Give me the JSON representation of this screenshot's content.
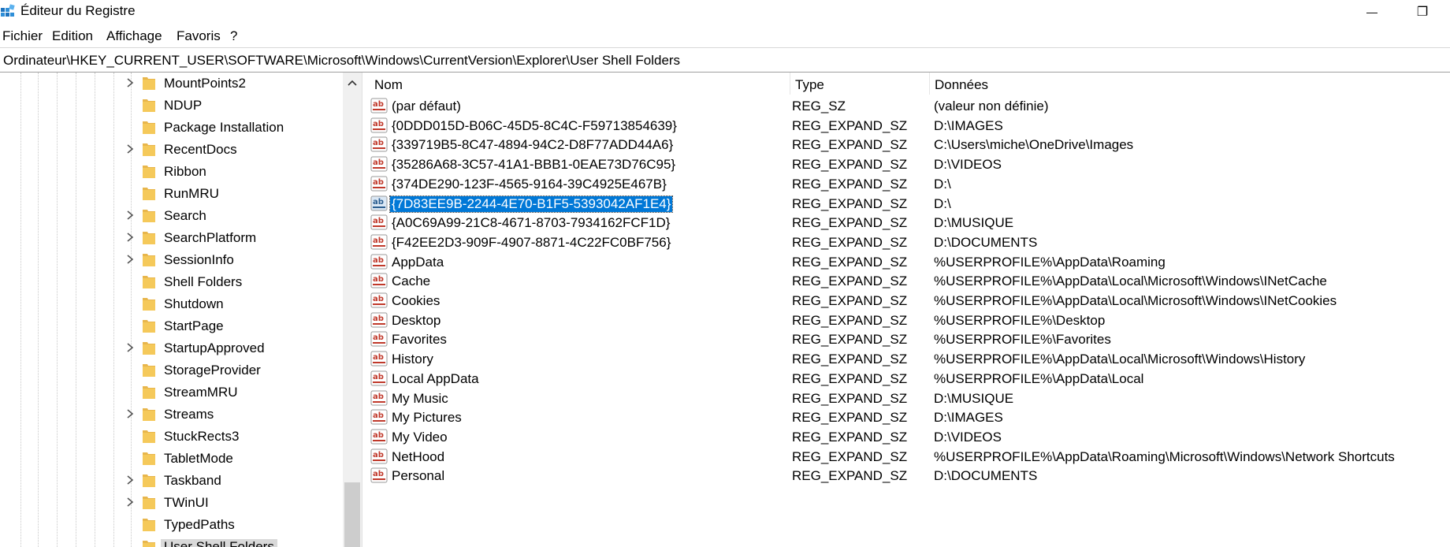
{
  "window": {
    "title": "Éditeur du Registre",
    "controls": {
      "minimize": "—",
      "restore": "❐"
    }
  },
  "menu": [
    "Fichier",
    "Edition",
    "Affichage",
    "Favoris",
    "?"
  ],
  "address": "Ordinateur\\HKEY_CURRENT_USER\\SOFTWARE\\Microsoft\\Windows\\CurrentVersion\\Explorer\\User Shell Folders",
  "tree": [
    {
      "label": "MountPoints2",
      "expandable": true
    },
    {
      "label": "NDUP",
      "expandable": false
    },
    {
      "label": "Package Installation",
      "expandable": false
    },
    {
      "label": "RecentDocs",
      "expandable": true
    },
    {
      "label": "Ribbon",
      "expandable": false
    },
    {
      "label": "RunMRU",
      "expandable": false
    },
    {
      "label": "Search",
      "expandable": true
    },
    {
      "label": "SearchPlatform",
      "expandable": true
    },
    {
      "label": "SessionInfo",
      "expandable": true
    },
    {
      "label": "Shell Folders",
      "expandable": false
    },
    {
      "label": "Shutdown",
      "expandable": false
    },
    {
      "label": "StartPage",
      "expandable": false
    },
    {
      "label": "StartupApproved",
      "expandable": true
    },
    {
      "label": "StorageProvider",
      "expandable": false
    },
    {
      "label": "StreamMRU",
      "expandable": false
    },
    {
      "label": "Streams",
      "expandable": true
    },
    {
      "label": "StuckRects3",
      "expandable": false
    },
    {
      "label": "TabletMode",
      "expandable": false
    },
    {
      "label": "Taskband",
      "expandable": true
    },
    {
      "label": "TWinUI",
      "expandable": true
    },
    {
      "label": "TypedPaths",
      "expandable": false
    },
    {
      "label": "User Shell Folders",
      "expandable": false,
      "selected": true
    }
  ],
  "columns": {
    "name": "Nom",
    "type": "Type",
    "data": "Données"
  },
  "values": [
    {
      "name": "(par défaut)",
      "type": "REG_SZ",
      "data": "(valeur non définie)"
    },
    {
      "name": "{0DDD015D-B06C-45D5-8C4C-F59713854639}",
      "type": "REG_EXPAND_SZ",
      "data": "D:\\IMAGES"
    },
    {
      "name": "{339719B5-8C47-4894-94C2-D8F77ADD44A6}",
      "type": "REG_EXPAND_SZ",
      "data": "C:\\Users\\miche\\OneDrive\\Images"
    },
    {
      "name": "{35286A68-3C57-41A1-BBB1-0EAE73D76C95}",
      "type": "REG_EXPAND_SZ",
      "data": "D:\\VIDEOS"
    },
    {
      "name": "{374DE290-123F-4565-9164-39C4925E467B}",
      "type": "REG_EXPAND_SZ",
      "data": "D:\\"
    },
    {
      "name": "{7D83EE9B-2244-4E70-B1F5-5393042AF1E4}",
      "type": "REG_EXPAND_SZ",
      "data": "D:\\",
      "selected": true
    },
    {
      "name": "{A0C69A99-21C8-4671-8703-7934162FCF1D}",
      "type": "REG_EXPAND_SZ",
      "data": "D:\\MUSIQUE"
    },
    {
      "name": "{F42EE2D3-909F-4907-8871-4C22FC0BF756}",
      "type": "REG_EXPAND_SZ",
      "data": "D:\\DOCUMENTS"
    },
    {
      "name": "AppData",
      "type": "REG_EXPAND_SZ",
      "data": "%USERPROFILE%\\AppData\\Roaming"
    },
    {
      "name": "Cache",
      "type": "REG_EXPAND_SZ",
      "data": "%USERPROFILE%\\AppData\\Local\\Microsoft\\Windows\\INetCache"
    },
    {
      "name": "Cookies",
      "type": "REG_EXPAND_SZ",
      "data": "%USERPROFILE%\\AppData\\Local\\Microsoft\\Windows\\INetCookies"
    },
    {
      "name": "Desktop",
      "type": "REG_EXPAND_SZ",
      "data": "%USERPROFILE%\\Desktop"
    },
    {
      "name": "Favorites",
      "type": "REG_EXPAND_SZ",
      "data": "%USERPROFILE%\\Favorites"
    },
    {
      "name": "History",
      "type": "REG_EXPAND_SZ",
      "data": "%USERPROFILE%\\AppData\\Local\\Microsoft\\Windows\\History"
    },
    {
      "name": "Local AppData",
      "type": "REG_EXPAND_SZ",
      "data": "%USERPROFILE%\\AppData\\Local"
    },
    {
      "name": "My Music",
      "type": "REG_EXPAND_SZ",
      "data": "D:\\MUSIQUE"
    },
    {
      "name": "My Pictures",
      "type": "REG_EXPAND_SZ",
      "data": "D:\\IMAGES"
    },
    {
      "name": "My Video",
      "type": "REG_EXPAND_SZ",
      "data": "D:\\VIDEOS"
    },
    {
      "name": "NetHood",
      "type": "REG_EXPAND_SZ",
      "data": "%USERPROFILE%\\AppData\\Roaming\\Microsoft\\Windows\\Network Shortcuts"
    },
    {
      "name": "Personal",
      "type": "REG_EXPAND_SZ",
      "data": "D:\\DOCUMENTS"
    }
  ],
  "icons": {
    "app": "registry-editor-icon",
    "folder": "folder-icon",
    "value": "string-value-icon",
    "expand": "chevron-right-icon",
    "scroll_up": "chevron-up-icon"
  },
  "colors": {
    "selection": "#0078d7",
    "folder": "#e8b64c",
    "value_icon": "#c0392b"
  }
}
